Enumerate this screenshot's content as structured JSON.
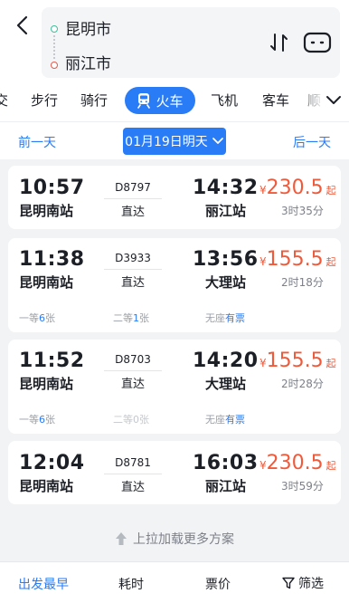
{
  "header": {
    "from_city": "昆明市",
    "to_city": "丽江市"
  },
  "tabs": {
    "items": [
      "交",
      "步行",
      "骑行",
      "火车",
      "飞机",
      "客车",
      "顺"
    ],
    "active": "火车"
  },
  "date_bar": {
    "prev_label": "前一天",
    "current_label": "01月19日明天",
    "next_label": "后一天"
  },
  "trains": [
    {
      "dep_time": "10:57",
      "dep_station": "昆明南站",
      "train_no": "D8797",
      "type": "直达",
      "arr_time": "14:32",
      "arr_station": "丽江站",
      "currency": "¥",
      "price": "230.5",
      "price_suffix": "起",
      "duration": "3时35分"
    },
    {
      "dep_time": "11:38",
      "dep_station": "昆明南站",
      "train_no": "D3933",
      "type": "直达",
      "arr_time": "13:56",
      "arr_station": "大理站",
      "currency": "¥",
      "price": "155.5",
      "price_suffix": "起",
      "duration": "2时18分",
      "seats": [
        {
          "label": "一等",
          "count": "6",
          "unit": "张"
        },
        {
          "label": "二等",
          "count": "1",
          "unit": "张"
        },
        {
          "label": "无座",
          "avail": "有票"
        }
      ]
    },
    {
      "dep_time": "11:52",
      "dep_station": "昆明南站",
      "train_no": "D8703",
      "type": "直达",
      "arr_time": "14:20",
      "arr_station": "大理站",
      "currency": "¥",
      "price": "155.5",
      "price_suffix": "起",
      "duration": "2时28分",
      "seats": [
        {
          "label": "一等",
          "count": "6",
          "unit": "张"
        },
        {
          "label": "二等",
          "count": "0",
          "unit": "张"
        },
        {
          "label": "无座",
          "avail": "有票"
        }
      ]
    },
    {
      "dep_time": "12:04",
      "dep_station": "昆明南站",
      "train_no": "D8781",
      "type": "直达",
      "arr_time": "16:03",
      "arr_station": "丽江站",
      "currency": "¥",
      "price": "230.5",
      "price_suffix": "起",
      "duration": "3时59分"
    }
  ],
  "load_more": "上拉加载更多方案",
  "bottom_bar": {
    "earliest": "出发最早",
    "time_cost": "耗时",
    "price": "票价",
    "filter": "筛选"
  },
  "colors": {
    "accent": "#2a7bf6",
    "price": "#f05a3a",
    "from_dot": "#3cbf9a",
    "to_dot": "#e15b4a"
  }
}
